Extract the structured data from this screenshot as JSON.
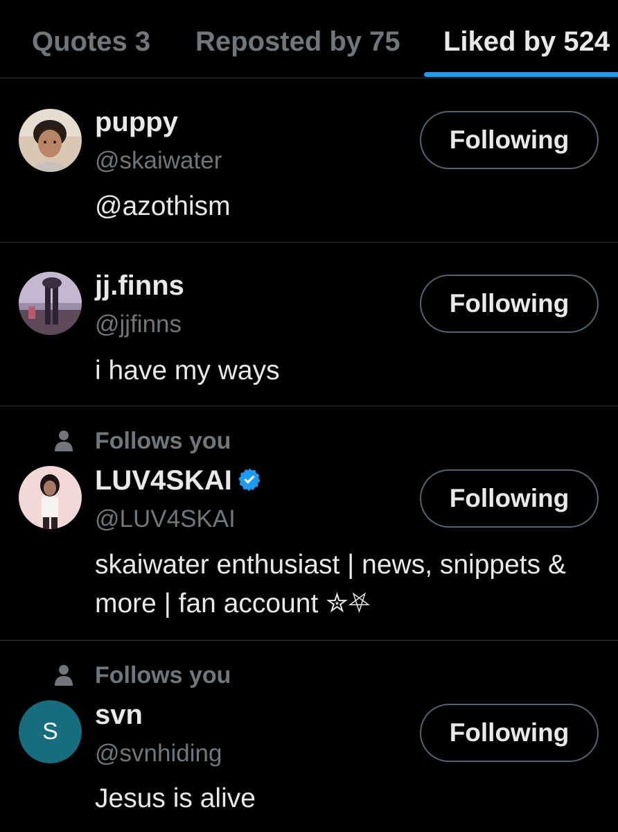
{
  "tabs": [
    {
      "label": "Quotes 3"
    },
    {
      "label": "Reposted by 75"
    },
    {
      "label": "Liked by 524",
      "active": true
    }
  ],
  "colors": {
    "background": "#000000",
    "accent": "#1d9bf0",
    "text_primary": "#e7e9ea",
    "text_secondary": "#71767b",
    "divider": "#2f3336"
  },
  "users": [
    {
      "name": "puppy",
      "handle": "@skaiwater",
      "bio": "@azothism",
      "button_label": "Following",
      "follows_you": ""
    },
    {
      "name": "jj.finns",
      "handle": "@jjfinns",
      "bio": "i have my ways",
      "button_label": "Following",
      "follows_you": ""
    },
    {
      "name": "LUV4SKAI",
      "handle": "@LUV4SKAI",
      "bio": "skaiwater enthusiast | news, snippets & more | fan account ✮⛧",
      "button_label": "Following",
      "follows_you": "Follows you",
      "verified": true,
      "verified_icon": "verified-badge-icon"
    },
    {
      "name": "svn",
      "handle": "@svnhiding",
      "bio": "Jesus is alive",
      "button_label": "Following",
      "follows_you": "Follows you",
      "avatar_letter": "S"
    }
  ]
}
